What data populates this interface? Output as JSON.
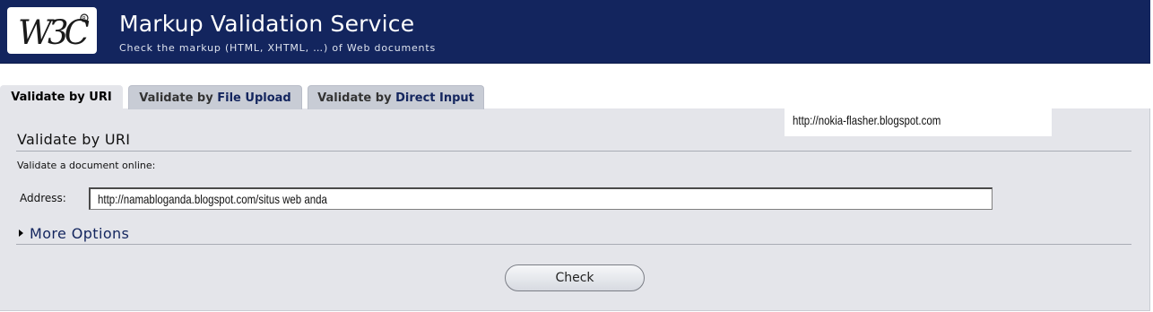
{
  "header": {
    "logo_text": "W3C",
    "title": "Markup Validation Service",
    "subtitle": "Check the markup (HTML, XHTML, …) of Web documents"
  },
  "tabs": [
    {
      "prefix": "Validate by ",
      "accent": "URI",
      "active": true
    },
    {
      "prefix": "Validate by ",
      "accent": "File Upload",
      "active": false
    },
    {
      "prefix": "Validate by ",
      "accent": "Direct Input",
      "active": false
    }
  ],
  "overlay_url": "http://nokia-flasher.blogspot.com",
  "form": {
    "section_title": "Validate by URI",
    "intro": "Validate a document online:",
    "address_label": "Address:",
    "address_value": "http://namabloganda.blogspot.com/situs web anda",
    "more_options": "More Options",
    "check_label": "Check"
  },
  "colors": {
    "banner": "#13255e",
    "panel": "#e4e5ea",
    "inactive_tab": "#c8ccd5",
    "accent_text": "#13255e"
  }
}
